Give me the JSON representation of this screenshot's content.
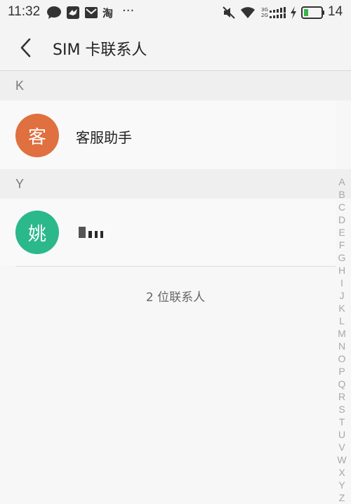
{
  "status_bar": {
    "time": "11:32",
    "battery_percent": "14",
    "icons": [
      "chat-icon",
      "bird-app-icon",
      "mail-icon",
      "taobao-icon",
      "more-dots-icon",
      "mute-icon",
      "wifi-icon",
      "signal-icon",
      "charging-icon",
      "battery-icon"
    ],
    "taobao_char": "淘",
    "more_dots": "···",
    "signal_top_label": "3G",
    "signal_bottom_label": "2G"
  },
  "header": {
    "title": "SIM 卡联系人"
  },
  "sections": [
    {
      "letter": "K",
      "contacts": [
        {
          "avatar_char": "客",
          "avatar_color": "#e0703f",
          "name": "客服助手"
        }
      ]
    },
    {
      "letter": "Y",
      "contacts": [
        {
          "avatar_char": "姚",
          "avatar_color": "#2bb88a",
          "name": ""
        }
      ]
    }
  ],
  "footer": {
    "count_text": "2 位联系人"
  },
  "alphabet_index": [
    "A",
    "B",
    "C",
    "D",
    "E",
    "F",
    "G",
    "H",
    "I",
    "J",
    "K",
    "L",
    "M",
    "N",
    "O",
    "P",
    "Q",
    "R",
    "S",
    "T",
    "U",
    "V",
    "W",
    "X",
    "Y",
    "Z"
  ]
}
